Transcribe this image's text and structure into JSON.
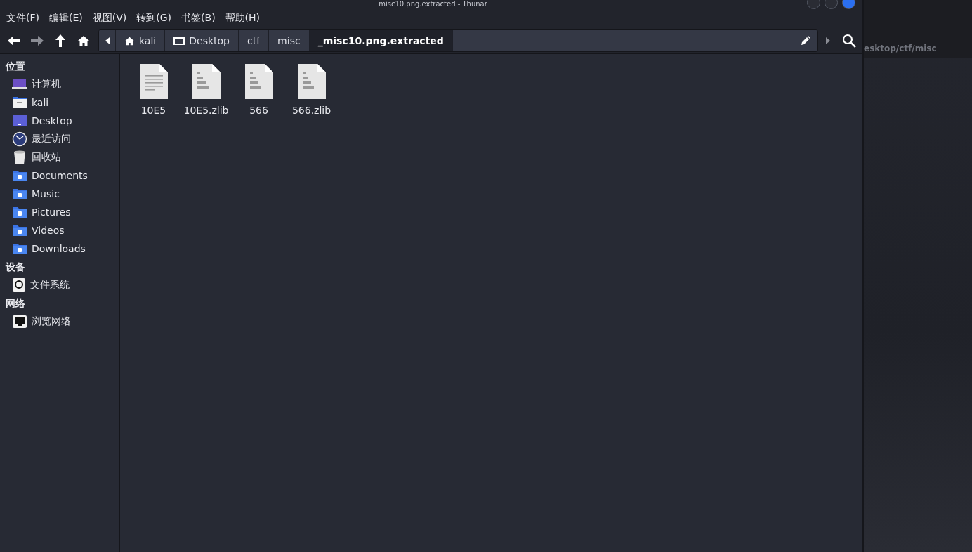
{
  "window": {
    "title": "_misc10.png.extracted - Thunar"
  },
  "menu": [
    "文件(F)",
    "编辑(E)",
    "视图(V)",
    "转到(G)",
    "书签(B)",
    "帮助(H)"
  ],
  "path": [
    {
      "label": "kali",
      "kind": "home",
      "selected": false
    },
    {
      "label": "Desktop",
      "kind": "desktop",
      "selected": false
    },
    {
      "label": "ctf",
      "kind": "plain",
      "selected": false
    },
    {
      "label": "misc",
      "kind": "plain",
      "selected": false
    },
    {
      "label": "_misc10.png.extracted",
      "kind": "plain",
      "selected": true
    }
  ],
  "sidebar": [
    {
      "heading": "位置",
      "items": [
        {
          "label": "计算机",
          "kind": "computer"
        },
        {
          "label": "kali",
          "kind": "home"
        },
        {
          "label": "Desktop",
          "kind": "desktop"
        },
        {
          "label": "最近访问",
          "kind": "recent"
        },
        {
          "label": "回收站",
          "kind": "trash"
        },
        {
          "label": "Documents",
          "kind": "documents"
        },
        {
          "label": "Music",
          "kind": "music"
        },
        {
          "label": "Pictures",
          "kind": "pictures"
        },
        {
          "label": "Videos",
          "kind": "videos"
        },
        {
          "label": "Downloads",
          "kind": "downloads"
        }
      ]
    },
    {
      "heading": "设备",
      "items": [
        {
          "label": "文件系统",
          "kind": "drive"
        }
      ]
    },
    {
      "heading": "网络",
      "items": [
        {
          "label": "浏览网络",
          "kind": "network"
        }
      ]
    }
  ],
  "files": [
    {
      "name": "10E5",
      "kind": "text"
    },
    {
      "name": "10E5.zlib",
      "kind": "binary"
    },
    {
      "name": "566",
      "kind": "binary"
    },
    {
      "name": "566.zlib",
      "kind": "binary"
    }
  ],
  "background_window": {
    "path": "esktop/ctf/misc"
  }
}
